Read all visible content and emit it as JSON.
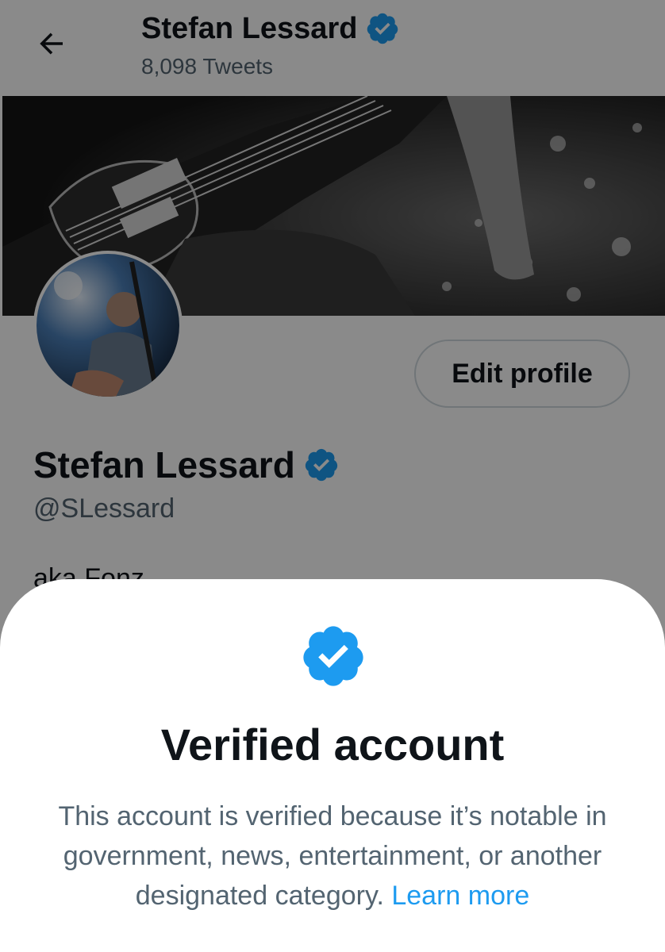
{
  "header": {
    "name": "Stefan Lessard",
    "tweet_count": "8,098 Tweets",
    "back_icon": "arrow-left-icon"
  },
  "profile": {
    "name": "Stefan Lessard",
    "handle": "@SLessard",
    "bio": "aka Fonz",
    "edit_button": "Edit profile",
    "banner_alt": "bass-guitar-banner-photo",
    "avatar_alt": "profile-avatar-photo"
  },
  "sheet": {
    "icon": "verified-badge-icon",
    "title": "Verified account",
    "body": "This account is verified because it’s notable in government, news, entertainment, or another designated category.",
    "link": "Learn more"
  },
  "colors": {
    "verified_blue": "#1d9bf0",
    "text_primary": "#0f1419",
    "text_secondary": "#536471",
    "dim_overlay": "rgba(0,0,0,0.46)"
  }
}
